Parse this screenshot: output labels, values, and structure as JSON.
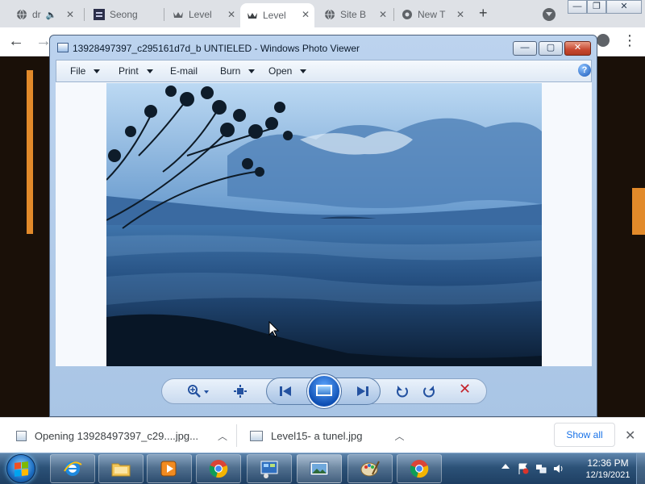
{
  "browser": {
    "tabs": [
      {
        "label": "dr",
        "icon": "globe-icon",
        "muted": true
      },
      {
        "label": "Seong",
        "icon": "site-logo-icon"
      },
      {
        "label": "Level",
        "icon": "crown-icon"
      },
      {
        "label": "Level",
        "icon": "crown-icon",
        "active": true
      },
      {
        "label": "Site B",
        "icon": "globe-icon"
      },
      {
        "label": "New T",
        "icon": "chrome-icon"
      }
    ],
    "new_tab_symbol": "+",
    "close_symbol": "✕",
    "back_symbol": "←",
    "forward_symbol": "→",
    "menu_symbol": "⋮"
  },
  "photo_viewer": {
    "title": "13928497397_c295161d7d_b UNTIELED - Windows Photo Viewer",
    "menu": [
      {
        "label": "File",
        "dropdown": true
      },
      {
        "label": "Print",
        "dropdown": true
      },
      {
        "label": "E-mail",
        "dropdown": false
      },
      {
        "label": "Burn",
        "dropdown": true
      },
      {
        "label": "Open",
        "dropdown": true
      }
    ],
    "help_symbol": "?",
    "minimize_symbol": "—",
    "maximize_symbol": "▢",
    "close_symbol": "✕"
  },
  "downloads": {
    "items": [
      {
        "label": "Opening 13928497397_c29....jpg..."
      },
      {
        "label": "Level15- a tunel.jpg"
      }
    ],
    "show_all": "Show all",
    "close_symbol": "✕",
    "chevron": "︿"
  },
  "taskbar": {
    "apps": [
      "internet-explorer-icon",
      "file-explorer-icon",
      "media-player-icon",
      "chrome-icon",
      "control-panel-icon",
      "photo-viewer-icon",
      "paint-icon",
      "chrome-alt-icon"
    ],
    "clock_time": "12:36 PM",
    "clock_date": "12/19/2021"
  },
  "colors": {
    "accent_orange": "#e28a2a",
    "photo_sky": "#bcd9f3",
    "photo_sea": "#0f2a48"
  }
}
